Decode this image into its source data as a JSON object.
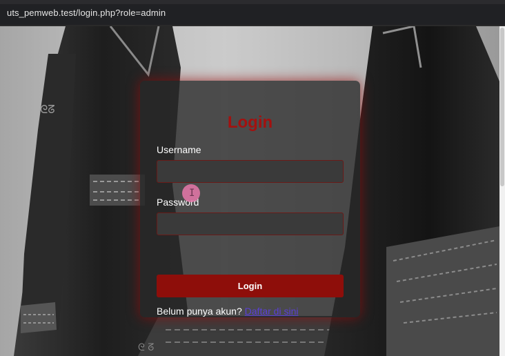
{
  "browser": {
    "url": "uts_pemweb.test/login.php?role=admin"
  },
  "login": {
    "title": "Login",
    "username_label": "Username",
    "username_value": "",
    "password_label": "Password",
    "password_value": "",
    "button_label": "Login",
    "register_prompt": "Belum punya akun?",
    "register_link": "Daftar di sini"
  },
  "cursor": {
    "glyph": "I"
  },
  "colors": {
    "accent": "#a3110f",
    "button": "#8e0e0a",
    "link": "#5b3fd8",
    "card_glow": "#960a0a"
  }
}
